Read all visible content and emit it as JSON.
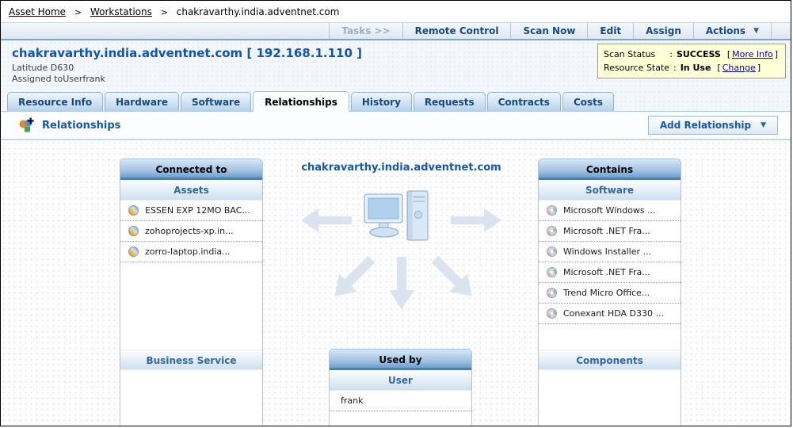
{
  "breadcrumb": {
    "separator": ">",
    "items": [
      {
        "label": "Asset Home"
      },
      {
        "label": "Workstations"
      },
      {
        "label": "chakravarthy.india.adventnet.com"
      }
    ]
  },
  "toolbar": {
    "tasks_label": "Tasks >>",
    "buttons": [
      {
        "label": "Remote Control"
      },
      {
        "label": "Scan Now"
      },
      {
        "label": "Edit"
      },
      {
        "label": "Assign"
      }
    ],
    "actions_label": "Actions",
    "dropdown_arrow": "▼"
  },
  "header": {
    "title": "chakravarthy.india.adventnet.com [ 192.168.1.110 ]",
    "model": "Latitude D630",
    "assigned_to": "Assigned toUserfrank",
    "scan_box": {
      "colon": ":",
      "bracket_open": "[",
      "bracket_close": "]",
      "scan_status_label": "Scan Status",
      "scan_status_value": "SUCCESS",
      "more_info_link": "More Info",
      "resource_state_label": "Resource State",
      "resource_state_value": "In Use",
      "change_link": "Change"
    }
  },
  "tabs": [
    {
      "label": "Resource Info",
      "active": false
    },
    {
      "label": "Hardware",
      "active": false
    },
    {
      "label": "Software",
      "active": false
    },
    {
      "label": "Relationships",
      "active": true
    },
    {
      "label": "History",
      "active": false
    },
    {
      "label": "Requests",
      "active": false
    },
    {
      "label": "Contracts",
      "active": false
    },
    {
      "label": "Costs",
      "active": false
    }
  ],
  "section": {
    "title": "Relationships",
    "add_relationship_label": "Add Relationship",
    "dropdown_arrow": "▼"
  },
  "diagram": {
    "center_title": "chakravarthy.india.adventnet.com",
    "panels": {
      "connected_to": {
        "title": "Connected to",
        "groups": [
          {
            "name": "Assets",
            "items": [
              {
                "label": "ESSEN EXP 12MO BAC..."
              },
              {
                "label": "zohoprojects-xp.in..."
              },
              {
                "label": "zorro-laptop.india..."
              }
            ]
          },
          {
            "name": "Business Service",
            "items": []
          }
        ]
      },
      "used_by": {
        "title": "Used by",
        "groups": [
          {
            "name": "User",
            "items": [
              {
                "label": "frank"
              }
            ]
          }
        ]
      },
      "contains": {
        "title": "Contains",
        "groups": [
          {
            "name": "Software",
            "items": [
              {
                "label": "Microsoft Windows ..."
              },
              {
                "label": "Microsoft .NET Fra..."
              },
              {
                "label": "Windows Installer ..."
              },
              {
                "label": "Microsoft .NET Fra..."
              },
              {
                "label": "Trend Micro Office..."
              },
              {
                "label": "Conexant HDA D330 ..."
              }
            ]
          },
          {
            "name": "Components",
            "items": []
          }
        ]
      }
    }
  },
  "icons": {
    "relationships_icon": "colored-shapes-plus",
    "asset_icon": "sphere",
    "software_icon": "disc",
    "computer_icon": "desktop-computer",
    "arrows": [
      "left",
      "right",
      "down-left",
      "down",
      "down-right"
    ]
  },
  "colors": {
    "accent_blue": "#1456b0",
    "tab_text": "#17497f",
    "panel_header_border": "#4d7fb5",
    "scan_box_bg": "#ffffd6",
    "link_blue": "#0000cc"
  }
}
